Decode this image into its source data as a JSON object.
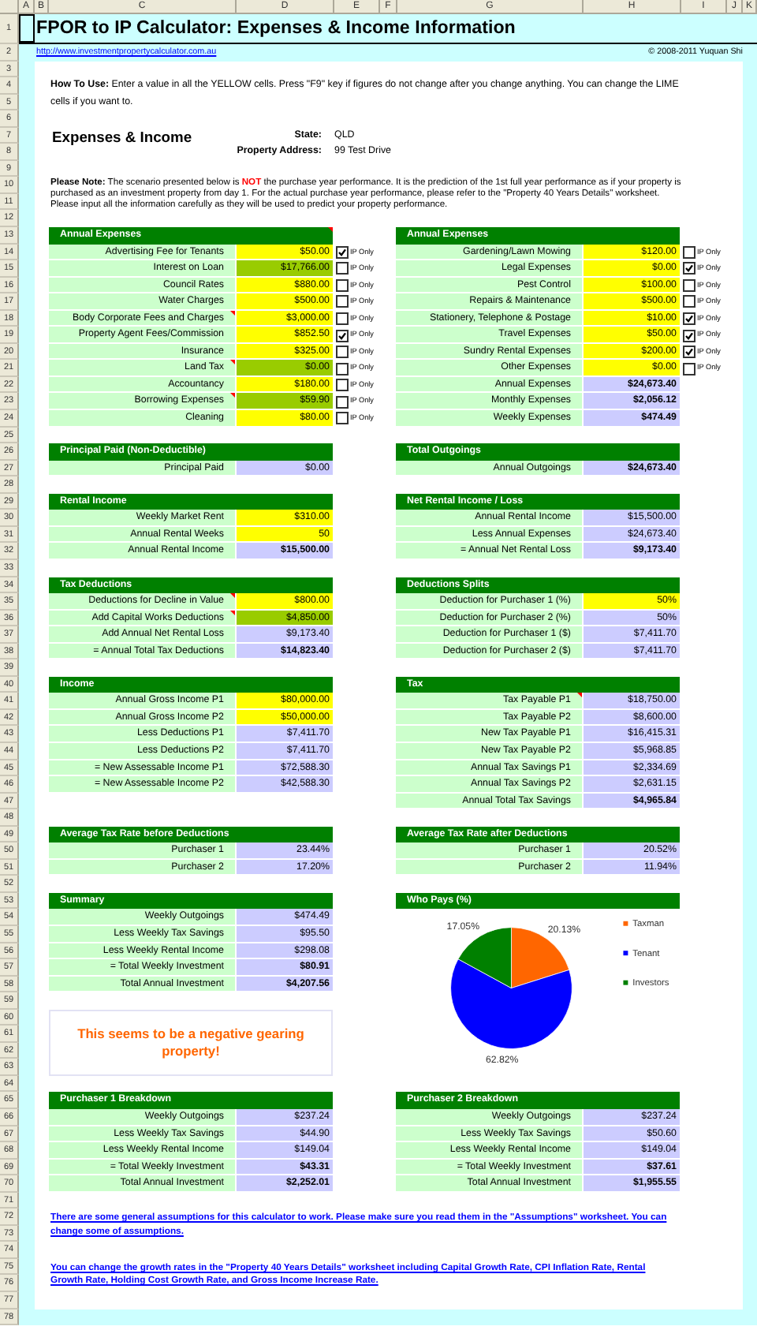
{
  "column_headers": [
    "A",
    "B",
    "C",
    "D",
    "E",
    "F",
    "G",
    "H",
    "I",
    "J",
    "K"
  ],
  "row_numbers": [
    "1",
    "2",
    "3",
    "4",
    "5",
    "6",
    "7",
    "8",
    "9",
    "10",
    "11",
    "12",
    "13",
    "14",
    "15",
    "16",
    "17",
    "18",
    "19",
    "20",
    "21",
    "22",
    "23",
    "24",
    "25",
    "26",
    "27",
    "28",
    "29",
    "30",
    "31",
    "32",
    "33",
    "34",
    "35",
    "36",
    "37",
    "38",
    "39",
    "40",
    "41",
    "42",
    "43",
    "44",
    "45",
    "46",
    "47",
    "48",
    "49",
    "50",
    "51",
    "52",
    "53",
    "54",
    "55",
    "56",
    "57",
    "58",
    "59",
    "60",
    "61",
    "62",
    "63",
    "64",
    "65",
    "66",
    "67",
    "68",
    "69",
    "70",
    "71",
    "72",
    "73",
    "74",
    "75",
    "76",
    "77",
    "78"
  ],
  "title": "FPOR to IP Calculator: Expenses & Income Information",
  "website_link": "http://www.investmentpropertycalculator.com.au",
  "copyright": "© 2008-2011 Yuquan Shi",
  "how_to_use": "**How To Use:** Enter a value in all the YELLOW cells. Press \"F9\" key if figures do not change after you change anything. You can change the LIME cells if you want to.",
  "heading": "Expenses & Income",
  "property": [
    {
      "label": "State:",
      "value": "QLD"
    },
    {
      "label": "Property Address:",
      "value": "99 Test Drive"
    }
  ],
  "note": "**Please Note:** The scenario presented below is **NOT** the purchase year performance. It is the prediction of the 1st full year performance as if your property is purchased as an investment property from day 1. For the actual purchase year performance, please refer to the \"Property 40 Years Details\" worksheet. Please input all the information carefully as they will be used to predict your property performance.",
  "blocks": [
    {
      "left": [
        {
          "kind": "table",
          "title": "Annual Expenses",
          "comment": true,
          "rows": [
            {
              "label": "Advertising Fee for Tenants",
              "value": "$50.00",
              "kind": "input",
              "ip_only": {
                "label": "IP Only",
                "checked": true
              }
            },
            {
              "label": "Interest on Loan",
              "value": "$17,766.00",
              "kind": "lime",
              "ip_only": {
                "label": "IP Only",
                "checked": false
              }
            },
            {
              "label": "Council Rates",
              "value": "$880.00",
              "kind": "input",
              "ip_only": {
                "label": "IP Only",
                "checked": false
              }
            },
            {
              "label": "Water Charges",
              "value": "$500.00",
              "kind": "input",
              "ip_only": {
                "label": "IP Only",
                "checked": false
              }
            },
            {
              "label": "Body Corporate Fees and Charges",
              "value": "$3,000.00",
              "kind": "input",
              "comment": true,
              "ip_only": {
                "label": "IP Only",
                "checked": false
              }
            },
            {
              "label": "Property Agent Fees/Commission",
              "value": "$852.50",
              "kind": "input",
              "ip_only": {
                "label": "IP Only",
                "checked": true
              }
            },
            {
              "label": "Insurance",
              "value": "$325.00",
              "kind": "input",
              "ip_only": {
                "label": "IP Only",
                "checked": false
              }
            },
            {
              "label": "Land Tax",
              "value": "$0.00",
              "kind": "lime",
              "comment": true,
              "ip_only": {
                "label": "IP Only",
                "checked": false
              }
            },
            {
              "label": "Accountancy",
              "value": "$180.00",
              "kind": "input",
              "ip_only": {
                "label": "IP Only",
                "checked": false
              }
            },
            {
              "label": "Borrowing Expenses",
              "value": "$59.90",
              "kind": "lime",
              "comment": true,
              "ip_only": {
                "label": "IP Only",
                "checked": false
              }
            },
            {
              "label": "Cleaning",
              "value": "$80.00",
              "kind": "input",
              "ip_only": {
                "label": "IP Only",
                "checked": false
              }
            }
          ]
        }
      ],
      "right": [
        {
          "kind": "table",
          "title": "Annual Expenses",
          "rows": [
            {
              "label": "Gardening/Lawn Mowing",
              "value": "$120.00",
              "kind": "input",
              "ip_only": {
                "label": "IP Only",
                "checked": false
              }
            },
            {
              "label": "Legal Expenses",
              "value": "$0.00",
              "kind": "input",
              "ip_only": {
                "label": "IP Only",
                "checked": true
              }
            },
            {
              "label": "Pest Control",
              "value": "$100.00",
              "kind": "input",
              "ip_only": {
                "label": "IP Only",
                "checked": false
              }
            },
            {
              "label": "Repairs & Maintenance",
              "value": "$500.00",
              "kind": "input",
              "ip_only": {
                "label": "IP Only",
                "checked": false
              }
            },
            {
              "label": "Stationery, Telephone & Postage",
              "value": "$10.00",
              "kind": "input",
              "ip_only": {
                "label": "IP Only",
                "checked": true
              }
            },
            {
              "label": "Travel Expenses",
              "value": "$50.00",
              "kind": "input",
              "ip_only": {
                "label": "IP Only",
                "checked": true
              }
            },
            {
              "label": "Sundry Rental Expenses",
              "value": "$200.00",
              "kind": "input",
              "ip_only": {
                "label": "IP Only",
                "checked": true
              }
            },
            {
              "label": "Other Expenses",
              "value": "$0.00",
              "kind": "input",
              "ip_only": {
                "label": "IP Only",
                "checked": false
              }
            },
            {
              "label": "Annual Expenses",
              "value": "$24,673.40",
              "kind": "total"
            },
            {
              "label": "Monthly Expenses",
              "value": "$2,056.12",
              "kind": "total"
            },
            {
              "label": "Weekly Expenses",
              "value": "$474.49",
              "kind": "total"
            }
          ]
        }
      ]
    },
    {
      "left": [
        {
          "kind": "table",
          "title": "Principal Paid (Non-Deductible)",
          "rows": [
            {
              "label": "Principal Paid",
              "value": "$0.00",
              "kind": "calc"
            }
          ]
        }
      ],
      "right": [
        {
          "kind": "table",
          "title": "Total Outgoings",
          "rows": [
            {
              "label": "Annual Outgoings",
              "value": "$24,673.40",
              "kind": "total"
            }
          ]
        }
      ]
    },
    {
      "left": [
        {
          "kind": "table",
          "title": "Rental Income",
          "rows": [
            {
              "label": "Weekly Market Rent",
              "value": "$310.00",
              "kind": "input"
            },
            {
              "label": "Annual Rental Weeks",
              "value": "50",
              "kind": "input"
            },
            {
              "label": "Annual Rental Income",
              "value": "$15,500.00",
              "kind": "total"
            }
          ]
        }
      ],
      "right": [
        {
          "kind": "table",
          "title": "Net Rental Income / Loss",
          "rows": [
            {
              "label": "Annual Rental Income",
              "value": "$15,500.00",
              "kind": "calc"
            },
            {
              "label": "Less Annual Expenses",
              "value": "$24,673.40",
              "kind": "calc"
            },
            {
              "label": "= Annual Net Rental Loss",
              "value": "$9,173.40",
              "kind": "total"
            }
          ]
        }
      ]
    },
    {
      "left": [
        {
          "kind": "table",
          "title": "Tax Deductions",
          "rows": [
            {
              "label": "Deductions for Decline in Value",
              "value": "$800.00",
              "kind": "input",
              "comment": true
            },
            {
              "label": "Add Capital Works Deductions",
              "value": "$4,850.00",
              "kind": "lime",
              "comment": true
            },
            {
              "label": "Add Annual Net Rental Loss",
              "value": "$9,173.40",
              "kind": "calc"
            },
            {
              "label": "= Annual Total Tax Deductions",
              "value": "$14,823.40",
              "kind": "total"
            }
          ]
        }
      ],
      "right": [
        {
          "kind": "table",
          "title": "Deductions Splits",
          "rows": [
            {
              "label": "Deduction for Purchaser 1 (%)",
              "value": "50%",
              "kind": "input"
            },
            {
              "label": "Deduction for Purchaser 2 (%)",
              "value": "50%",
              "kind": "calc"
            },
            {
              "label": "Deduction for Purchaser 1 ($)",
              "value": "$7,411.70",
              "kind": "calc"
            },
            {
              "label": "Deduction for Purchaser 2 ($)",
              "value": "$7,411.70",
              "kind": "calc"
            }
          ]
        }
      ]
    },
    {
      "left": [
        {
          "kind": "table",
          "title": "Income",
          "rows": [
            {
              "label": "Annual Gross Income P1",
              "value": "$80,000.00",
              "kind": "input"
            },
            {
              "label": "Annual Gross Income P2",
              "value": "$50,000.00",
              "kind": "input"
            },
            {
              "label": "Less Deductions P1",
              "value": "$7,411.70",
              "kind": "calc"
            },
            {
              "label": "Less Deductions P2",
              "value": "$7,411.70",
              "kind": "calc"
            },
            {
              "label": "= New Assessable Income P1",
              "value": "$72,588.30",
              "kind": "calc"
            },
            {
              "label": "= New Assessable Income P2",
              "value": "$42,588.30",
              "kind": "calc"
            }
          ]
        }
      ],
      "right": [
        {
          "kind": "table",
          "title": "Tax",
          "rows": [
            {
              "label": "Tax Payable P1",
              "value": "$18,750.00",
              "kind": "calc",
              "comment": true
            },
            {
              "label": "Tax Payable P2",
              "value": "$8,600.00",
              "kind": "calc"
            },
            {
              "label": "New Tax Payable P1",
              "value": "$16,415.31",
              "kind": "calc"
            },
            {
              "label": "New Tax Payable P2",
              "value": "$5,968.85",
              "kind": "calc"
            },
            {
              "label": "Annual Tax Savings P1",
              "value": "$2,334.69",
              "kind": "calc"
            },
            {
              "label": "Annual Tax Savings P2",
              "value": "$2,631.15",
              "kind": "calc"
            },
            {
              "label": "Annual Total Tax Savings",
              "value": "$4,965.84",
              "kind": "total"
            }
          ]
        }
      ]
    },
    {
      "left": [
        {
          "kind": "table",
          "title": "Average Tax Rate before Deductions",
          "rows": [
            {
              "label": "Purchaser 1",
              "value": "23.44%",
              "kind": "calc"
            },
            {
              "label": "Purchaser 2",
              "value": "17.20%",
              "kind": "calc"
            }
          ]
        }
      ],
      "right": [
        {
          "kind": "table",
          "title": "Average Tax Rate after Deductions",
          "rows": [
            {
              "label": "Purchaser 1",
              "value": "20.52%",
              "kind": "calc"
            },
            {
              "label": "Purchaser 2",
              "value": "11.94%",
              "kind": "calc"
            }
          ]
        }
      ]
    },
    {
      "left": [
        {
          "kind": "table",
          "title": "Summary",
          "rows": [
            {
              "label": "Weekly Outgoings",
              "value": "$474.49",
              "kind": "calc"
            },
            {
              "label": "Less Weekly Tax Savings",
              "value": "$95.50",
              "kind": "calc"
            },
            {
              "label": "Less Weekly Rental Income",
              "value": "$298.08",
              "kind": "calc"
            },
            {
              "label": "= Total Weekly Investment",
              "value": "$80.91",
              "kind": "total"
            },
            {
              "label": "Total Annual Investment",
              "value": "$4,207.56",
              "kind": "total"
            }
          ]
        },
        {
          "kind": "message",
          "text": "This seems to be a negative gearing property!"
        }
      ],
      "right": [
        {
          "kind": "chart",
          "title": "Who Pays (%)",
          "chart_data": {
            "type": "pie",
            "categories": [
              "Taxman",
              "Tenant",
              "Investors"
            ],
            "colors": [
              "#ff6600",
              "#0000ff",
              "#008000"
            ],
            "legend": "right",
            "series": [
              {
                "values": [
                  20.13,
                  62.82,
                  17.05
                ]
              }
            ],
            "value_labels": [
              "20.13%",
              "62.82%",
              "17.05%"
            ]
          }
        }
      ]
    },
    {
      "left": [
        {
          "kind": "table",
          "title": "Purchaser 1 Breakdown",
          "rows": [
            {
              "label": "Weekly Outgoings",
              "value": "$237.24",
              "kind": "calc"
            },
            {
              "label": "Less Weekly Tax Savings",
              "value": "$44.90",
              "kind": "calc"
            },
            {
              "label": "Less Weekly Rental Income",
              "value": "$149.04",
              "kind": "calc"
            },
            {
              "label": "= Total Weekly Investment",
              "value": "$43.31",
              "kind": "total"
            },
            {
              "label": "Total Annual Investment",
              "value": "$2,252.01",
              "kind": "total"
            }
          ]
        }
      ],
      "right": [
        {
          "kind": "table",
          "title": "Purchaser 2 Breakdown",
          "rows": [
            {
              "label": "Weekly Outgoings",
              "value": "$237.24",
              "kind": "calc"
            },
            {
              "label": "Less Weekly Tax Savings",
              "value": "$50.60",
              "kind": "calc"
            },
            {
              "label": "Less Weekly Rental Income",
              "value": "$149.04",
              "kind": "calc"
            },
            {
              "label": "= Total Weekly Investment",
              "value": "$37.61",
              "kind": "total"
            },
            {
              "label": "Total Annual Investment",
              "value": "$1,955.55",
              "kind": "total"
            }
          ]
        }
      ]
    }
  ],
  "links": [
    "There are some general assumptions for this calculator to work. Please make sure you read them in the \"Assumptions\" worksheet. You can change some of assumptions.",
    "You can change the growth rates in the \"Property 40 Years Details\" worksheet including Capital Growth Rate, CPI Inflation Rate, Rental Growth Rate, Holding Cost Growth Rate, and Gross Income Increase Rate."
  ]
}
